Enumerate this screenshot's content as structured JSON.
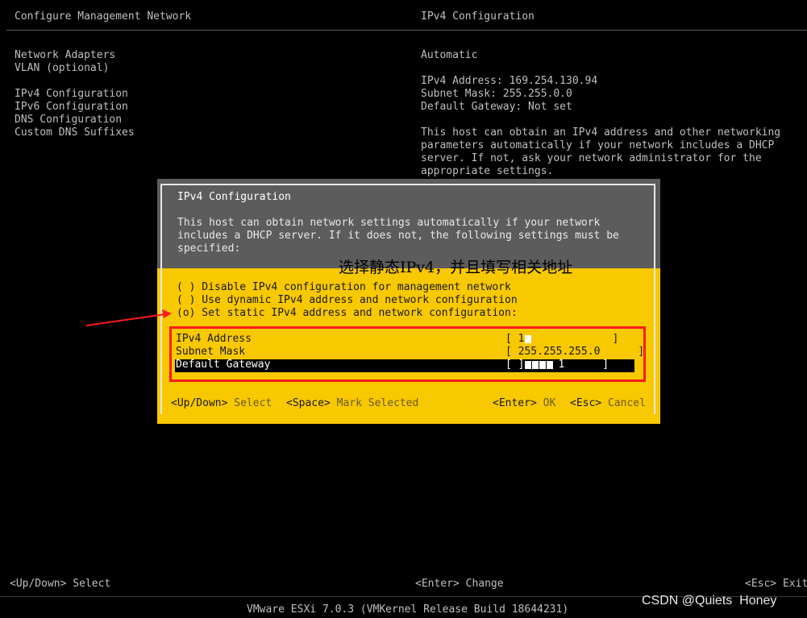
{
  "left_header": "Configure Management Network",
  "right_header": "IPv4 Configuration",
  "menu": [
    "Network Adapters",
    "VLAN (optional)",
    "IPv4 Configuration",
    "IPv6 Configuration",
    "DNS Configuration",
    "Custom DNS Suffixes"
  ],
  "info": {
    "mode": "Automatic",
    "ipv4_address": "IPv4 Address: 169.254.130.94",
    "subnet_mask": "Subnet Mask: 255.255.0.0",
    "default_gateway": "Default Gateway: Not set",
    "description": [
      "This host can obtain an IPv4 address and other networking",
      "parameters automatically if your network includes a DHCP",
      "server. If not, ask your network administrator for the",
      "appropriate settings."
    ]
  },
  "dialog": {
    "title": "IPv4 Configuration",
    "description": [
      "This host can obtain network settings automatically if your network",
      "includes a DHCP server. If it does not, the following settings must be",
      "specified:"
    ],
    "options": [
      "( ) Disable IPv4 configuration for management network",
      "( ) Use dynamic IPv4 address and network configuration",
      "(o) Set static IPv4 address and network configuration:"
    ],
    "fields": {
      "ipv4_label": "IPv4 Address",
      "ipv4_value": "[ 1",
      "subnet_label": "Subnet Mask",
      "subnet_value": "[ 255.255.255.0      ]",
      "gateway_label": "Default Gateway",
      "gateway_value": "[ ]",
      "gateway_tail": "1      ]"
    },
    "footer": {
      "updown_key": "<Up/Down>",
      "updown_action": "Select",
      "space_key": "<Space>",
      "space_action": "Mark Selected",
      "enter_key": "<Enter>",
      "enter_action": "OK",
      "esc_key": "<Esc>",
      "esc_action": "Cancel"
    }
  },
  "annotation": "选择静态IPv4，并且填写相关地址",
  "bottom_bar": {
    "updown": "<Up/Down> Select",
    "enter": "<Enter> Change",
    "esc": "<Esc> Exit"
  },
  "version": "VMware ESXi 7.0.3 (VMKernel Release Build 18644231)",
  "watermark": "CSDN @Quiets  Honey",
  "colors": {
    "dialog_yellow": "#f8c800",
    "dialog_grey": "#5c5c5c",
    "highlight_red": "#ff1a1a"
  }
}
